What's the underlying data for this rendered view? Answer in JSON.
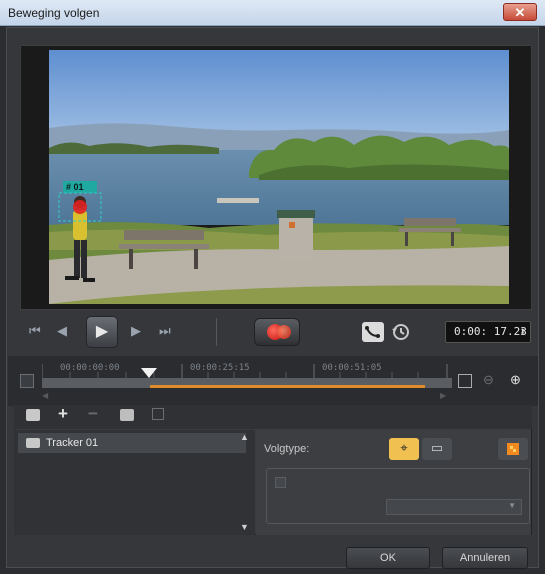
{
  "window": {
    "title": "Beweging volgen",
    "close_glyph": "✕"
  },
  "video": {
    "tracker_tag": "# 01"
  },
  "transport": {
    "go_start": "⏮",
    "prev_frame": "◀",
    "play": "▶",
    "next_frame": "▶",
    "go_end": "⏭",
    "timecode": "0:00: 17.23",
    "spin_glyph": "⬍"
  },
  "timeline": {
    "marks": [
      "00:00:00:00",
      "00:00:25:15",
      "00:00:51:05"
    ]
  },
  "toolbar": {
    "add": "+",
    "remove": "−"
  },
  "trackers": [
    {
      "label": "Tracker 01"
    }
  ],
  "properties": {
    "track_type_label": "Volgtype:"
  },
  "footer": {
    "ok": "OK",
    "cancel": "Annuleren"
  },
  "colors": {
    "accent": "#e08a2a",
    "record": "#d02010",
    "tag": "#2fd0c8",
    "selected_mode": "#f0c050"
  }
}
